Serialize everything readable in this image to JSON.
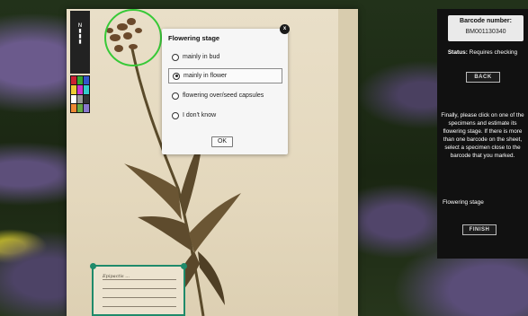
{
  "dialog": {
    "title": "Flowering stage",
    "close_glyph": "x",
    "options": [
      {
        "label": "mainly in bud",
        "selected": false
      },
      {
        "label": "mainly in flower",
        "selected": true
      },
      {
        "label": "flowering over/seed capsules",
        "selected": false
      },
      {
        "label": "I don't know",
        "selected": false
      }
    ],
    "ok_label": "OK"
  },
  "sidebar": {
    "barcode_title": "Barcode number:",
    "barcode_value": "BM001130340",
    "status_label": "Status:",
    "status_value": "Requires checking",
    "back_label": "BACK",
    "instructions": "Finally, please click on one of the specimens and estimate its flowering stage. If there is more than one barcode on the sheet, select a specimen close to the barcode that you marked.",
    "flowering_label": "Flowering stage",
    "finish_label": "FINISH"
  },
  "specimen": {
    "label_lines": [
      "Epipactis ... ",
      "... ",
      "... ",
      "... "
    ]
  },
  "colors": {
    "highlight_circle": "#37c937",
    "label_box_border": "#1f8a6a",
    "sidebar_bg": "#111111"
  }
}
